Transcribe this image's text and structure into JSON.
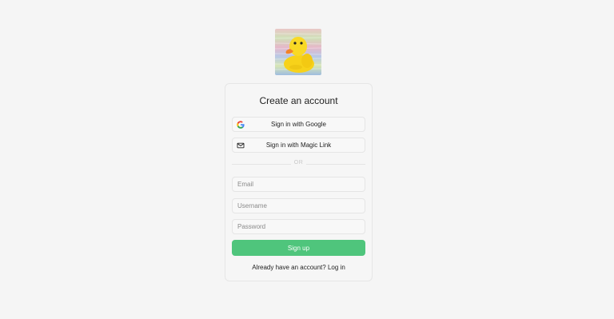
{
  "logo": {
    "icon": "rubber-duck-logo"
  },
  "card": {
    "title": "Create an account",
    "google_button": {
      "label": "Sign in with Google",
      "icon": "google-icon"
    },
    "magic_button": {
      "label": "Sign in with Magic Link",
      "icon": "mail-icon"
    },
    "divider_text": "OR",
    "email": {
      "placeholder": "Email",
      "value": ""
    },
    "username": {
      "placeholder": "Username",
      "value": ""
    },
    "password": {
      "placeholder": "Password",
      "value": ""
    },
    "signup_label": "Sign up",
    "footer_text": "Already have an account?",
    "login_link": "Log in"
  },
  "colors": {
    "background": "#f5f5f5",
    "primary": "#4fc57c",
    "border": "#e5e5e5"
  }
}
